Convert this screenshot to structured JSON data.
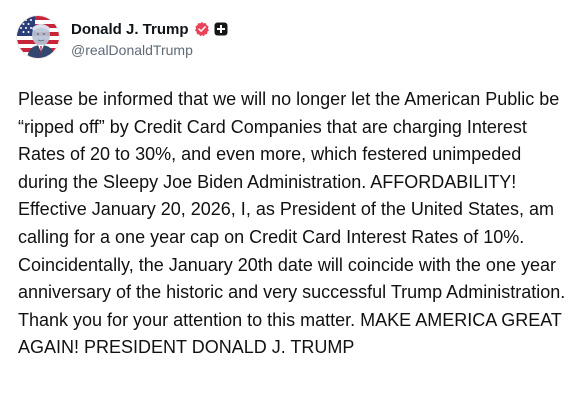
{
  "author": {
    "display_name": "Donald J. Trump",
    "handle": "@realDonaldTrump",
    "avatar_icon": "avatar-portrait-flag",
    "verified_icon": "verified-badge-icon",
    "verified_color": "#e8435a",
    "extra_badge_icon": "plus-badge-icon"
  },
  "post": {
    "text": "Please be informed that we will no longer let the American Public be “ripped off” by Credit Card Companies that are charging Interest Rates of 20 to 30%, and even more, which festered unimpeded during the Sleepy Joe Biden Administration. AFFORDABILITY! Effective January 20, 2026, I, as President of the United States, am calling for a one year cap on Credit Card Interest Rates of 10%. Coincidentally, the January 20th date will coincide with the one year anniversary of the historic and very successful Trump Administration. Thank you for your attention to this matter. MAKE AMERICA GREAT AGAIN! PRESIDENT DONALD J. TRUMP"
  },
  "colors": {
    "text": "#111111",
    "handle": "#5e6b77",
    "background": "#ffffff"
  }
}
